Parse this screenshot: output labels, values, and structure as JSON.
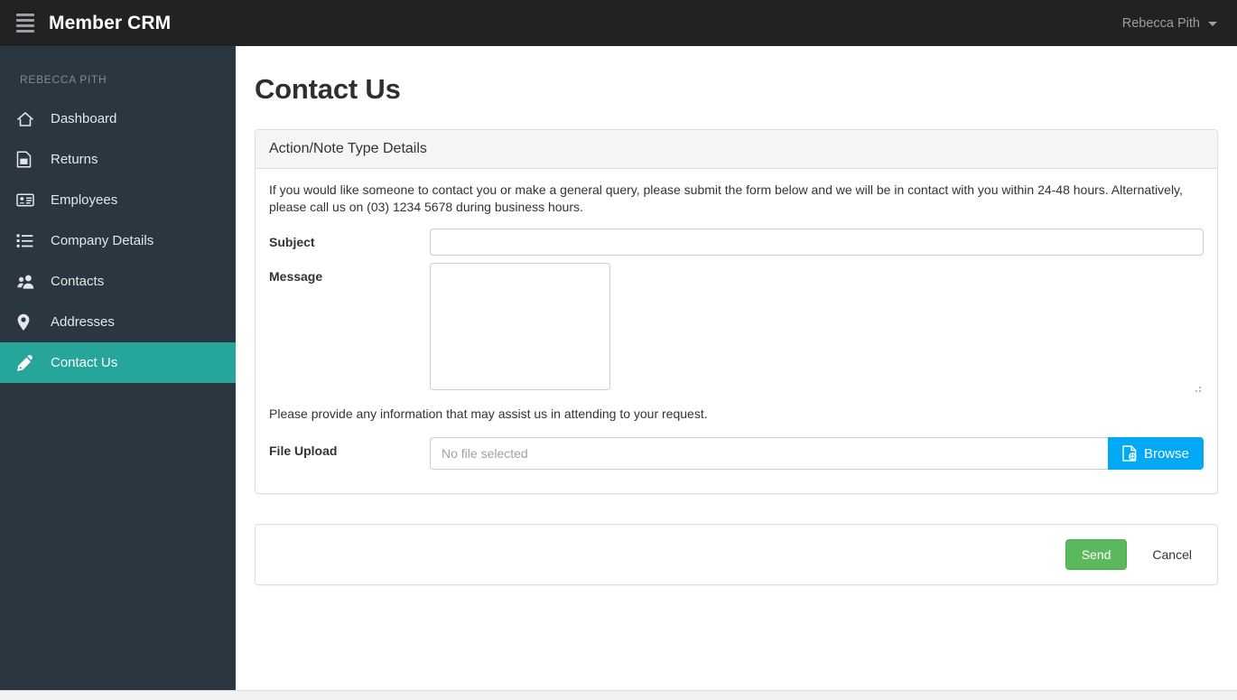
{
  "navbar": {
    "brand": "Member CRM",
    "menu_icon": "hamburger-icon",
    "user_name": "Rebecca Pith",
    "user_caret_icon": "chevron-down-icon"
  },
  "sidebar": {
    "heading": "REBECCA PITH",
    "items": [
      {
        "label": "Dashboard",
        "icon": "home-icon",
        "active": false
      },
      {
        "label": "Returns",
        "icon": "report-icon",
        "active": false
      },
      {
        "label": "Employees",
        "icon": "id-card-icon",
        "active": false
      },
      {
        "label": "Company Details",
        "icon": "list-icon",
        "active": false
      },
      {
        "label": "Contacts",
        "icon": "people-icon",
        "active": false
      },
      {
        "label": "Addresses",
        "icon": "map-pin-icon",
        "active": false
      },
      {
        "label": "Contact Us",
        "icon": "pencil-icon",
        "active": true
      }
    ],
    "active_color": "#26a69a",
    "background_color": "#2a3740"
  },
  "main": {
    "page_title": "Contact Us",
    "panel": {
      "heading": "Action/Note Type Details",
      "intro": "If you would like someone to contact you or make a general query, please submit the form below and we will be in contact with you within 24-48 hours. Alternatively, please call us on (03) 1234 5678 during business hours.",
      "fields": {
        "subject_label": "Subject",
        "subject_value": "",
        "subject_placeholder": "",
        "message_label": "Message",
        "message_value": "",
        "message_placeholder": "",
        "helper_text": "Please provide any information that may assist us in attending to your request.",
        "file_label": "File Upload",
        "file_value": "No file selected",
        "browse_label": "Browse",
        "browse_icon": "file-add-icon"
      }
    },
    "actions": {
      "send_label": "Send",
      "cancel_label": "Cancel",
      "send_color": "#5cb85c",
      "browse_color": "#03a9f4"
    }
  }
}
